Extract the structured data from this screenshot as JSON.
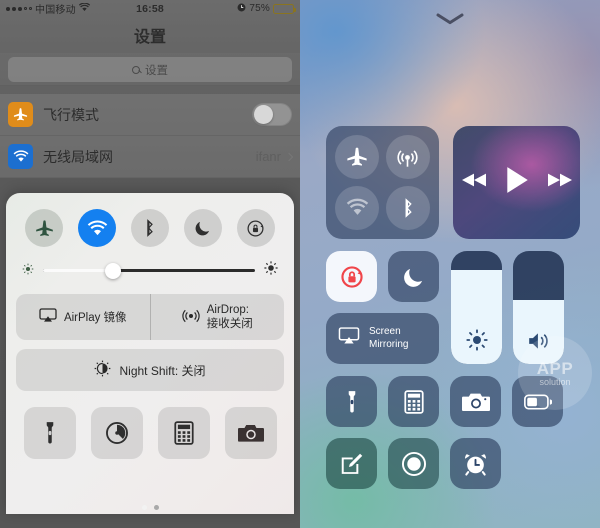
{
  "left": {
    "statusbar": {
      "signal_filled": 3,
      "signal_empty": 2,
      "carrier": "中国移动",
      "wifi_icon": "wifi-icon",
      "time": "16:58",
      "alarm_icon": "alarm-icon",
      "battery_percent": "75%",
      "battery_level": 75,
      "battery_color": "#d9a521"
    },
    "nav_title": "设置",
    "search": {
      "placeholder": "设置",
      "icon": "search-icon"
    },
    "rows": [
      {
        "label": "飞行模式",
        "icon": "airplane-icon",
        "icon_color": "#e08c1a",
        "control": "toggle",
        "value": ""
      },
      {
        "label": "无线局域网",
        "icon": "wifi-icon",
        "icon_color": "#1c6fd0",
        "control": "chevron",
        "value": "ifanr"
      }
    ],
    "control_center": {
      "toggles": [
        {
          "name": "airplane-mode-toggle",
          "icon": "airplane-icon",
          "active": false
        },
        {
          "name": "wifi-toggle",
          "icon": "wifi-icon",
          "active": true
        },
        {
          "name": "bluetooth-toggle",
          "icon": "bluetooth-icon",
          "active": false
        },
        {
          "name": "do-not-disturb-toggle",
          "icon": "moon-icon",
          "active": false
        },
        {
          "name": "rotation-lock-toggle",
          "icon": "rotation-lock-icon",
          "active": false
        }
      ],
      "brightness": {
        "value": 33,
        "low_icon": "brightness-low-icon",
        "high_icon": "brightness-high-icon"
      },
      "airplay_label": "AirPlay 镜像",
      "airplay_icon": "airplay-icon",
      "airdrop_line1": "AirDrop:",
      "airdrop_line2": "接收关闭",
      "airdrop_icon": "airdrop-icon",
      "nightshift_label": "Night Shift: 关闭",
      "nightshift_icon": "nightshift-icon",
      "apps": [
        {
          "name": "flashlight-shortcut",
          "icon": "flashlight-icon"
        },
        {
          "name": "timer-shortcut",
          "icon": "timer-icon"
        },
        {
          "name": "calculator-shortcut",
          "icon": "calculator-icon"
        },
        {
          "name": "camera-shortcut",
          "icon": "camera-icon"
        }
      ],
      "page_dots": [
        {
          "active": true
        },
        {
          "active": false
        }
      ]
    }
  },
  "right": {
    "grabber_icon": "chevron-down-icon",
    "connectivity": [
      {
        "name": "airplane-mode-button",
        "icon": "airplane-icon",
        "active": false
      },
      {
        "name": "cellular-data-button",
        "icon": "cellular-icon",
        "active": false
      },
      {
        "name": "wifi-button",
        "icon": "wifi-icon",
        "active": false
      },
      {
        "name": "bluetooth-button",
        "icon": "bluetooth-icon",
        "active": false
      }
    ],
    "music": {
      "rewind_icon": "rewind-icon",
      "play_icon": "play-icon",
      "forward_icon": "fast-forward-icon"
    },
    "rotation_lock": {
      "icon": "rotation-lock-icon",
      "active": true,
      "active_color": "#f0454a"
    },
    "do_not_disturb": {
      "icon": "moon-icon",
      "active": false
    },
    "screen_mirroring": {
      "line1": "Screen",
      "line2": "Mirroring",
      "icon": "airplay-icon"
    },
    "brightness_slider": {
      "value": 83,
      "icon": "brightness-icon"
    },
    "volume_slider": {
      "value": 57,
      "icon": "volume-icon"
    },
    "apps_row1": [
      {
        "name": "flashlight-button",
        "icon": "flashlight-icon"
      },
      {
        "name": "calculator-button",
        "icon": "calculator-icon"
      },
      {
        "name": "camera-button",
        "icon": "camera-icon"
      },
      {
        "name": "low-power-mode-button",
        "icon": "battery-icon"
      }
    ],
    "apps_row2": [
      {
        "name": "notes-button",
        "icon": "notes-icon"
      },
      {
        "name": "screen-record-button",
        "icon": "record-icon"
      },
      {
        "name": "alarm-button",
        "icon": "alarm-clock-icon"
      }
    ],
    "watermark": {
      "line1": "APP",
      "line2": "solution"
    }
  }
}
